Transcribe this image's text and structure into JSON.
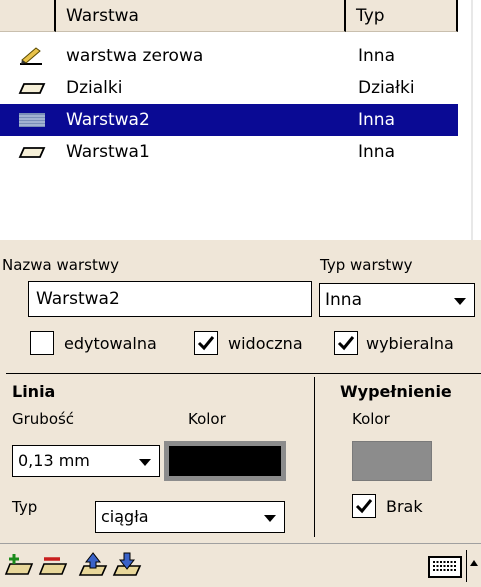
{
  "layer_list": {
    "headers": {
      "name": "Warstwa",
      "type": "Typ"
    },
    "rows": [
      {
        "icon": "pencil-layer-icon",
        "name": "warstwa zerowa",
        "type": "Inna",
        "selected": false
      },
      {
        "icon": "layer-plane-icon",
        "name": "Dzialki",
        "type": "Działki",
        "selected": false
      },
      {
        "icon": "layer-hatched-icon",
        "name": "Warstwa2",
        "type": "Inna",
        "selected": true
      },
      {
        "icon": "layer-plane-icon",
        "name": "Warstwa1",
        "type": "Inna",
        "selected": false
      }
    ]
  },
  "properties": {
    "name_label": "Nazwa warstwy",
    "name_value": "Warstwa2",
    "type_label": "Typ warstwy",
    "type_value": "Inna",
    "editable_label": "edytowalna",
    "editable_checked": false,
    "visible_label": "widoczna",
    "visible_checked": true,
    "selectable_label": "wybieralna",
    "selectable_checked": true
  },
  "line": {
    "heading": "Linia",
    "thickness_label": "Grubość",
    "thickness_value": "0,13 mm",
    "color_label": "Kolor",
    "color": "#000000",
    "type_label": "Typ",
    "type_value": "ciągła"
  },
  "fill": {
    "heading": "Wypełnienie",
    "color_label": "Kolor",
    "color": "#8c8c8c",
    "none_label": "Brak",
    "none_checked": true
  },
  "toolbar": {
    "buttons": [
      "add-layer-icon",
      "remove-layer-icon",
      "move-layer-up-icon",
      "move-layer-down-icon"
    ],
    "keyboard_icon": "keyboard-icon"
  },
  "colors": {
    "panel_bg": "#efe6d8",
    "selection": "#0a0a94"
  }
}
